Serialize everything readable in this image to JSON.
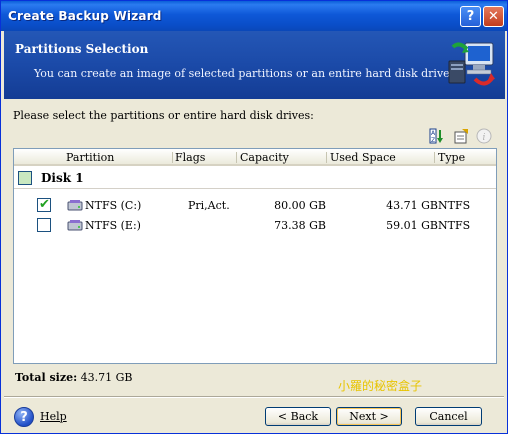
{
  "window": {
    "title": "Create Backup Wizard",
    "help_glyph": "?",
    "close_glyph": "✕"
  },
  "header": {
    "title": "Partitions Selection",
    "subtitle": "You can create an image of selected partitions or an entire hard disk drive."
  },
  "prompt": "Please select the partitions or entire hard disk drives:",
  "toolbar_icons": [
    "sort-icon",
    "properties-icon",
    "info-icon"
  ],
  "table": {
    "columns": [
      "Partition",
      "Flags",
      "Capacity",
      "Used Space",
      "Type"
    ],
    "disk": {
      "label": "Disk 1",
      "checked": "partial"
    },
    "rows": [
      {
        "name": "NTFS (C:)",
        "flags": "Pri,Act.",
        "capacity": "80.00 GB",
        "used": "43.71 GB",
        "type": "NTFS",
        "checked": true
      },
      {
        "name": "NTFS (E:)",
        "flags": "",
        "capacity": "73.38 GB",
        "used": "59.01 GB",
        "type": "NTFS",
        "checked": false
      }
    ]
  },
  "total": {
    "label": "Total size:",
    "value": "43.71 GB"
  },
  "watermark": "小羅的秘密盒子",
  "footer": {
    "help": "Help",
    "back": "< Back",
    "next": "Next >",
    "cancel": "Cancel"
  },
  "colors": {
    "title_bar": "#0a4ec8",
    "header_bg": "#1b4aa8",
    "check_green": "#21a121",
    "watermark": "#e8c400"
  }
}
